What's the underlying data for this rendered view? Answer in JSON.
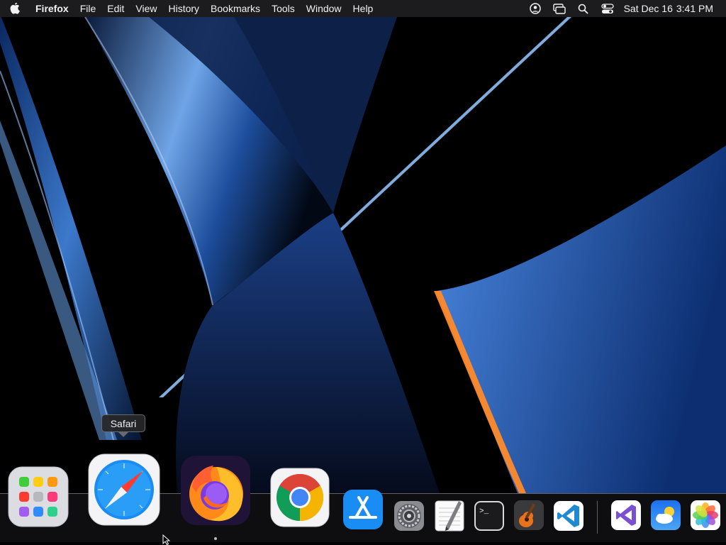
{
  "menubar": {
    "app_name": "Firefox",
    "menus": [
      "File",
      "Edit",
      "View",
      "History",
      "Bookmarks",
      "Tools",
      "Window",
      "Help"
    ],
    "status_icons": [
      "user-account-icon",
      "screen-mirroring-icon",
      "spotlight-search-icon",
      "control-center-icon"
    ],
    "clock": {
      "date": "Sat Dec 16",
      "time": "3:41 PM"
    }
  },
  "tooltip": {
    "text": "Safari"
  },
  "dock": {
    "apps": [
      "launchpad",
      "safari",
      "firefox",
      "chrome",
      "app-store",
      "system-preferences",
      "textedit",
      "terminal",
      "garageband",
      "vscode",
      "visual-studio",
      "weather",
      "photos"
    ],
    "hovered_app": "safari",
    "running_indicator_app": "firefox"
  },
  "colors": {
    "menubar_bg": "#1e1e22",
    "wallpaper_blue": "#3d7fd8",
    "wallpaper_dark": "#000000",
    "accent_orange": "#ff7a1a"
  }
}
